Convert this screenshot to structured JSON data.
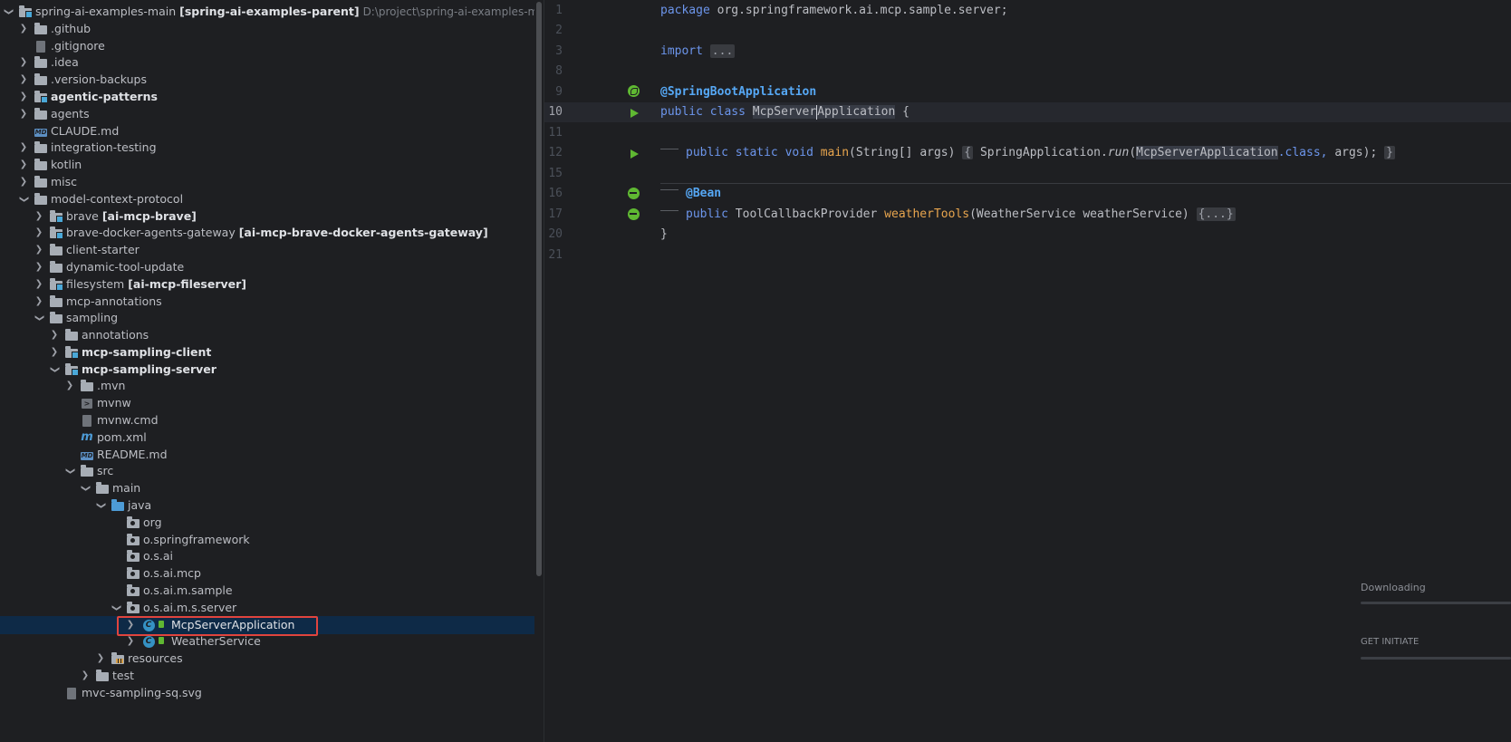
{
  "project_tree": {
    "root": {
      "name": "spring-ai-examples-main",
      "module": "[spring-ai-examples-parent]",
      "path": "D:\\project\\spring-ai-examples-main\\spring-a"
    },
    "items": [
      {
        "label": ".github"
      },
      {
        "label": ".gitignore"
      },
      {
        "label": ".idea"
      },
      {
        "label": ".version-backups"
      },
      {
        "label": "agentic-patterns"
      },
      {
        "label": "agents"
      },
      {
        "label": "CLAUDE.md"
      },
      {
        "label": "integration-testing"
      },
      {
        "label": "kotlin"
      },
      {
        "label": "misc"
      },
      {
        "label": "model-context-protocol"
      },
      {
        "label": "brave",
        "module": "[ai-mcp-brave]"
      },
      {
        "label": "brave-docker-agents-gateway",
        "module": "[ai-mcp-brave-docker-agents-gateway]"
      },
      {
        "label": "client-starter"
      },
      {
        "label": "dynamic-tool-update"
      },
      {
        "label": "filesystem",
        "module": "[ai-mcp-fileserver]"
      },
      {
        "label": "mcp-annotations"
      },
      {
        "label": "sampling"
      },
      {
        "label": "annotations"
      },
      {
        "label": "mcp-sampling-client"
      },
      {
        "label": "mcp-sampling-server"
      },
      {
        "label": ".mvn"
      },
      {
        "label": "mvnw"
      },
      {
        "label": "mvnw.cmd"
      },
      {
        "label": "pom.xml"
      },
      {
        "label": "README.md"
      },
      {
        "label": "src"
      },
      {
        "label": "main"
      },
      {
        "label": "java"
      },
      {
        "label": "org"
      },
      {
        "label": "o.springframework"
      },
      {
        "label": "o.s.ai"
      },
      {
        "label": "o.s.ai.mcp"
      },
      {
        "label": "o.s.ai.m.sample"
      },
      {
        "label": "o.s.ai.m.s.server"
      },
      {
        "label": "McpServerApplication"
      },
      {
        "label": "WeatherService"
      },
      {
        "label": "resources"
      },
      {
        "label": "test"
      },
      {
        "label": "mvc-sampling-sq.svg"
      }
    ]
  },
  "editor": {
    "line_numbers": [
      "1",
      "2",
      "3",
      "8",
      "9",
      "10",
      "11",
      "12",
      "15",
      "16",
      "17",
      "20",
      "21"
    ],
    "tokens": {
      "package_kw": "package",
      "package_name": "org.springframework.ai.mcp.sample.server;",
      "import_kw": "import",
      "fold_dots": "...",
      "annotation_sba": "@SpringBootApplication",
      "public_kw": "public",
      "class_kw": "class",
      "class_name_a": "McpServer",
      "class_name_b": "Application",
      "brace_open": "{",
      "static_kw": "static",
      "void_kw": "void",
      "main_fn": "main",
      "main_params": "(String[] args)",
      "main_body_open": "{",
      "spring_app": "SpringApplication.",
      "run_fn": "run",
      "paren_open": "(",
      "main_class_ref": "McpServerApplication",
      "dot_class": ".class,",
      "args_tail": "args);",
      "main_body_close": "}",
      "annotation_bean": "@Bean",
      "return_type": "ToolCallbackProvider",
      "weather_fn": "weatherTools",
      "weather_params": "(WeatherService weatherService)",
      "fold_block": "{...}",
      "brace_close": "}"
    }
  },
  "download_panel": {
    "downloading_text": "Downloading",
    "get_initiated_text": "GET INITIATE"
  }
}
